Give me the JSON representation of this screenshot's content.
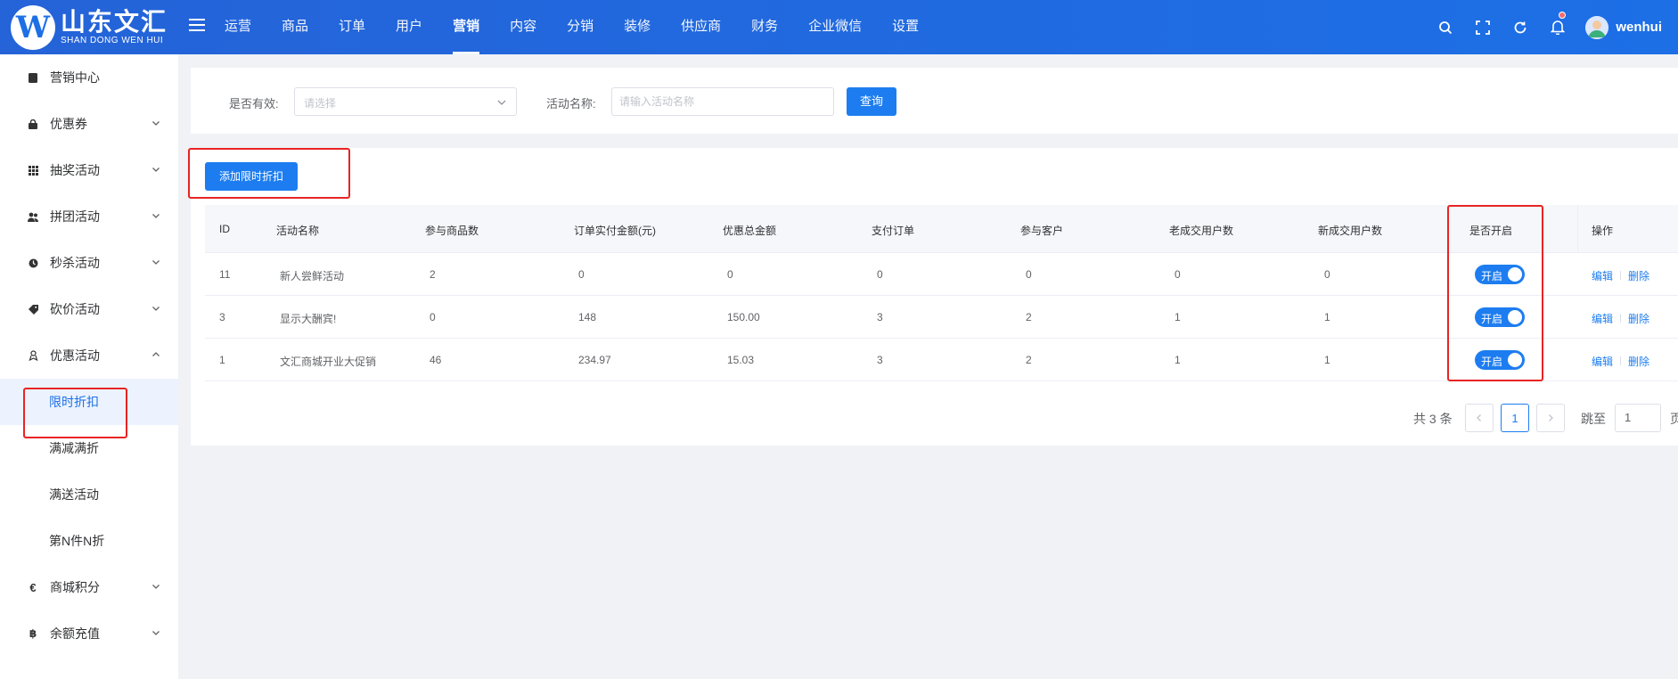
{
  "header": {
    "logo_cn": "山东文汇",
    "logo_en": "SHAN DONG WEN HUI",
    "logo_mark": "W",
    "nav": [
      "运营",
      "商品",
      "订单",
      "用户",
      "营销",
      "内容",
      "分销",
      "装修",
      "供应商",
      "财务",
      "企业微信",
      "设置"
    ],
    "active_nav": "营销",
    "username": "wenhui",
    "icons": [
      "search-icon",
      "fullscreen-icon",
      "refresh-icon",
      "bell-icon"
    ]
  },
  "sidebar": {
    "items": [
      {
        "label": "营销中心",
        "icon": "marketing-center-icon",
        "expandable": false
      },
      {
        "label": "优惠券",
        "icon": "coupon-icon",
        "expandable": true
      },
      {
        "label": "抽奖活动",
        "icon": "lottery-icon",
        "expandable": true
      },
      {
        "label": "拼团活动",
        "icon": "group-buy-icon",
        "expandable": true
      },
      {
        "label": "秒杀活动",
        "icon": "flash-sale-icon",
        "expandable": true
      },
      {
        "label": "砍价活动",
        "icon": "bargain-icon",
        "expandable": true
      },
      {
        "label": "优惠活动",
        "icon": "promotion-icon",
        "expandable": true,
        "expanded": true
      }
    ],
    "sub_items": [
      "限时折扣",
      "满减满折",
      "满送活动",
      "第N件N折"
    ],
    "active_sub": "限时折扣",
    "bottom_items": [
      {
        "label": "商城积分",
        "icon": "euro-icon"
      },
      {
        "label": "余额充值",
        "icon": "bitcoin-icon"
      }
    ]
  },
  "filter": {
    "valid_label": "是否有效:",
    "valid_placeholder": "请选择",
    "name_label": "活动名称:",
    "name_placeholder": "请输入活动名称",
    "query_button": "查询"
  },
  "toolbar": {
    "add_button": "添加限时折扣"
  },
  "table": {
    "columns": [
      "ID",
      "活动名称",
      "参与商品数",
      "订单实付金额(元)",
      "优惠总金额",
      "支付订单",
      "参与客户",
      "老成交用户数",
      "新成交用户数",
      "是否开启",
      "操作"
    ],
    "rows": [
      {
        "id": "11",
        "name": "新人尝鲜活动",
        "goods": "2",
        "paid": "0",
        "discount": "0",
        "orders": "0",
        "customers": "0",
        "old_users": "0",
        "new_users": "0",
        "enabled": "开启",
        "on": true
      },
      {
        "id": "3",
        "name": "显示大酬宾!",
        "goods": "0",
        "paid": "148",
        "discount": "150.00",
        "orders": "3",
        "customers": "2",
        "old_users": "1",
        "new_users": "1",
        "enabled": "开启",
        "on": true
      },
      {
        "id": "1",
        "name": "文汇商城开业大促销",
        "goods": "46",
        "paid": "234.97",
        "discount": "15.03",
        "orders": "3",
        "customers": "2",
        "old_users": "1",
        "new_users": "1",
        "enabled": "开启",
        "on": true
      }
    ],
    "edit_label": "编辑",
    "delete_label": "删除"
  },
  "pagination": {
    "total": "共 3 条",
    "current_page": "1",
    "jump_label": "跳至",
    "jump_value": "1",
    "page_suffix": "页"
  },
  "colors": {
    "primary": "#1d7df0",
    "header_bg": "#1f6ee8",
    "highlight_border": "#e82424"
  }
}
